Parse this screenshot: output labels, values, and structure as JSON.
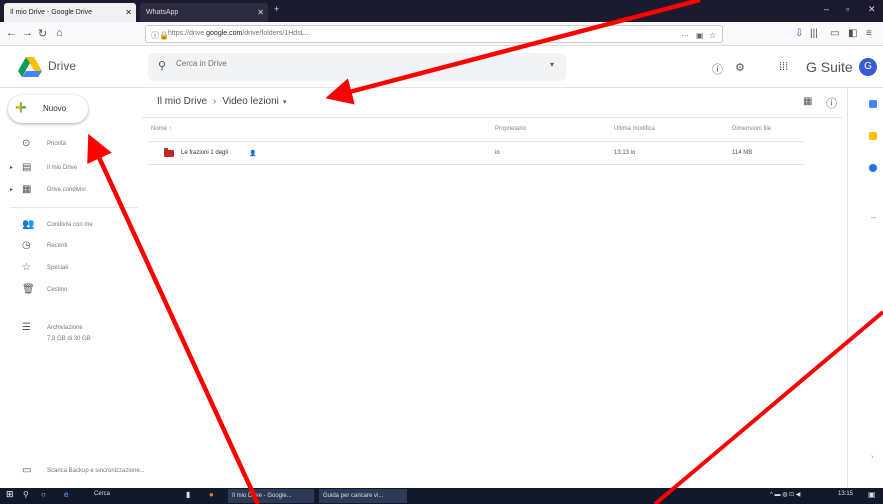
{
  "browser": {
    "tabs": [
      {
        "label": "Il mio Drive - Google Drive"
      },
      {
        "label": "WhatsApp"
      }
    ],
    "new_tab_label": "+",
    "window_controls": [
      "–",
      "▫",
      "✕"
    ],
    "url_prefix": "https://drive.",
    "url_domain": "google.com",
    "url_suffix": "/drive/folders/1HdsL..."
  },
  "header": {
    "logo_text": "Drive",
    "search_placeholder": "Cerca in Drive",
    "brand": "G Suite",
    "avatar_initial": "G"
  },
  "sidebar": {
    "new_label": "Nuovo",
    "items": [
      {
        "label": "Priorità",
        "icon": "priority-icon"
      },
      {
        "label": "Il mio Drive",
        "icon": "my-drive-icon"
      },
      {
        "label": "Drive condivisi",
        "icon": "shared-drives-icon"
      },
      {
        "label": "Condivisi con me",
        "icon": "shared-with-me-icon"
      },
      {
        "label": "Recenti",
        "icon": "recent-icon"
      },
      {
        "label": "Speciali",
        "icon": "starred-icon"
      },
      {
        "label": "Cestino",
        "icon": "trash-icon"
      },
      {
        "label": "Archiviazione",
        "icon": "storage-icon"
      }
    ],
    "storage_used": "7,8 GB di 30 GB",
    "bottom_item": "Scarica Backup e sincronizzazione..."
  },
  "main": {
    "breadcrumb_root": "Il mio Drive",
    "breadcrumb_sep": "›",
    "breadcrumb_current": "Video lezioni",
    "columns": {
      "name": "Nome ↑",
      "owner": "Proprietario",
      "modified": "Ultima modifica",
      "size": "Dimensioni file"
    },
    "rows": [
      {
        "name": "Le frazioni 1 degli",
        "owner": "io",
        "modified": "13:13 io",
        "size": "114 MB"
      }
    ]
  },
  "taskbar": {
    "search": "Cerca",
    "app1": "Il mio Drive - Google...",
    "app2": "Guida per caricare vi...",
    "clock": "13:15"
  }
}
